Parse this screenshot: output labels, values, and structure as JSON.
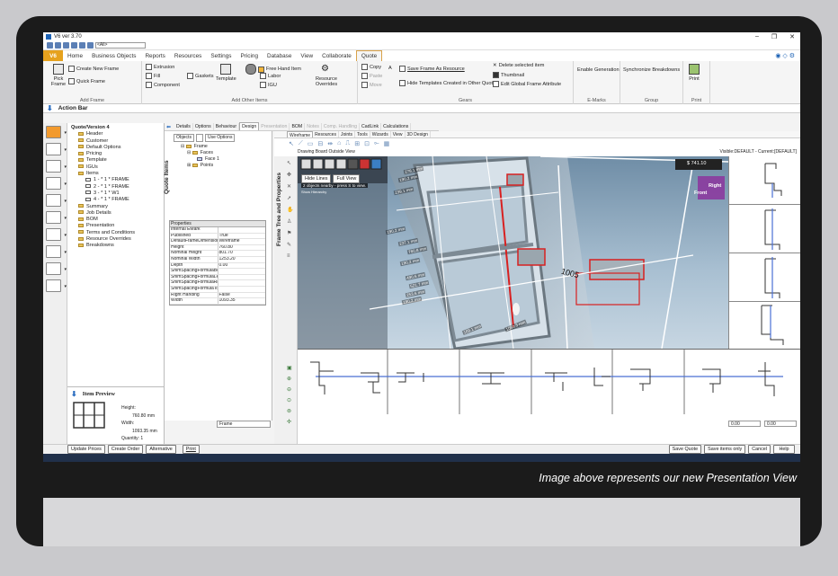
{
  "app": {
    "title": "V6 ver 3.70",
    "combo": "<All>"
  },
  "tabs": [
    "Home",
    "Business Objects",
    "Reports",
    "Resources",
    "Settings",
    "Pricing",
    "Database",
    "View",
    "Collaborate",
    "Quote"
  ],
  "tab_home": "V6",
  "ribbon": {
    "pick_frame": "Pick Frame",
    "create_new_frame": "Create New Frame",
    "quick_frame": "Quick Frame",
    "add_frame_label": "Add Frame",
    "extrusion": "Extrusion",
    "fill": "Fill",
    "component": "Component",
    "gaskets": "Gaskets",
    "template": "Template",
    "free_hand": "Free Hand Item",
    "labor": "Labor",
    "igu": "IGU",
    "resource_overrides": "Resource Overrides",
    "add_other_label": "Add Other Items",
    "copy": "Copy",
    "paste": "Paste",
    "move": "Move",
    "save_frame": "Save Frame As Resource",
    "hide_templates": "Hide Templates Created in Other Quotes",
    "delete_item": "Delete selected item",
    "thumbnail": "Thumbnail",
    "edit_global": "Edit Global Frame Attribute",
    "gears_label": "Gears",
    "enable_generation": "Enable Generation",
    "emarks_label": "E-Marks",
    "sync": "Synchronize Breakdowns",
    "group_label": "Group",
    "print": "Print",
    "print_label": "Print"
  },
  "action_bar": "Action Bar",
  "tree": [
    {
      "label": "Quote/Version 4",
      "indent": 0
    },
    {
      "label": "Header",
      "indent": 1
    },
    {
      "label": "Customer",
      "indent": 1
    },
    {
      "label": "Default Options",
      "indent": 1
    },
    {
      "label": "Pricing",
      "indent": 1
    },
    {
      "label": "Template",
      "indent": 1
    },
    {
      "label": "IGUs",
      "indent": 1
    },
    {
      "label": "Items",
      "indent": 1
    },
    {
      "label": "1 - * 1 * FRAME",
      "indent": 2
    },
    {
      "label": "2 - * 1 * FRAME",
      "indent": 2
    },
    {
      "label": "3 - * 1 * W1",
      "indent": 2
    },
    {
      "label": "4 - * 1 * FRAME",
      "indent": 2
    },
    {
      "label": "Summary",
      "indent": 1
    },
    {
      "label": "Job Details",
      "indent": 1
    },
    {
      "label": "BOM",
      "indent": 1
    },
    {
      "label": "Presentation",
      "indent": 1
    },
    {
      "label": "Terms and Conditions",
      "indent": 1
    },
    {
      "label": "Resource Overrides",
      "indent": 1
    },
    {
      "label": "Breakdowns",
      "indent": 1
    }
  ],
  "preview": {
    "title": "Item Preview",
    "height_label": "Height:",
    "height": "760.80",
    "height_unit": "mm",
    "width_label": "Width:",
    "width": "1093.35",
    "width_unit": "mm",
    "qty_label": "Quantity:",
    "qty": "1"
  },
  "subtabs": [
    "Details",
    "Options",
    "Behaviour",
    "Design",
    "Presentation",
    "BOM",
    "Notes",
    "Comp. Handling",
    "CadLink",
    "Calculations"
  ],
  "items_panel": {
    "objects": "Objects",
    "use_options": "Use Options",
    "vertical_label": "Quote Items",
    "tree": [
      "Frame",
      "Faces",
      "Face 1",
      "Points"
    ]
  },
  "properties": {
    "header": "Properties",
    "rows": [
      [
        "Internal EMark",
        ""
      ],
      [
        "Published",
        "True"
      ],
      [
        "DefaultFrameDimension",
        "Wireframe"
      ],
      [
        "Height",
        "760.80"
      ],
      [
        "Nominal Height",
        "801.70"
      ],
      [
        "Nominal Width",
        "1253.20"
      ],
      [
        "Depth",
        "0.00"
      ],
      [
        "ShimSpacingFormulaBott",
        ""
      ],
      [
        "ShimSpacingFormulaLeft",
        ""
      ],
      [
        "ShimSpacingFormulaRigh",
        ""
      ],
      [
        "ShimSpacingFormulaTop",
        ""
      ],
      [
        "Right Handing",
        "False"
      ],
      [
        "Width",
        "1093.35"
      ]
    ]
  },
  "frame_tree_label": "Frame Tree and Properties",
  "viewtabs": [
    "Wireframe",
    "Resources",
    "Joints",
    "Tools",
    "Wizards",
    "View",
    "3D Design"
  ],
  "drawing_board": "Drawing Board Outside View",
  "visible_label": "Visible:DEFAULT - Current:[DEFAULT]",
  "scene": {
    "hide_lines": "Hide Lines",
    "full_view": "Full View",
    "msg": "2 objects nearby - press S to view.",
    "msg2": "Show Hierarchy",
    "price": "$ 741.10",
    "cube_front": "Front",
    "cube_right": "Right",
    "label_1005": "1005",
    "dims": [
      "278.1 mm",
      "190.2 mm",
      "239.1 mm",
      "190.2 mm",
      "237.1 mm",
      "760.8 mm",
      "190.2 mm",
      "490.6 mm",
      "521.7 mm",
      "253.6 mm",
      "190.2 mm",
      "169.1 mm",
      "1093.3 mm"
    ]
  },
  "status": {
    "frame": "Frame",
    "v1": "0.00",
    "v2": "0.00"
  },
  "buttons": {
    "update_prices": "Update Prices",
    "create_order": "Create Order",
    "alternative": "Alternative",
    "print": "Print",
    "save_quote": "Save Quote",
    "save_items": "Save items only",
    "cancel": "Cancel",
    "help": "Help"
  },
  "caption": "Image above represents our new Presentation View",
  "colors": {
    "accent": "#e6a21e",
    "sky": "#9fb9cf",
    "frame": "#7d8a94",
    "highlight": "#d82020",
    "bezel": "#1b1b1b"
  }
}
